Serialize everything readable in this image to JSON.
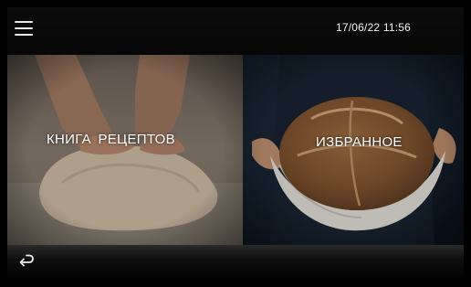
{
  "header": {
    "menu_icon": "hamburger-menu-icon",
    "datetime": "17/06/22 11:56"
  },
  "tiles": [
    {
      "label": "КНИГА  РЕЦЕПТОВ",
      "image": "hands-kneading-dough"
    },
    {
      "label": "ИЗБРАННОЕ",
      "image": "hands-holding-bread-loaf"
    }
  ],
  "footer": {
    "back_icon": "back-arrow-icon"
  },
  "colors": {
    "background": "#000000",
    "text": "#ffffff"
  }
}
